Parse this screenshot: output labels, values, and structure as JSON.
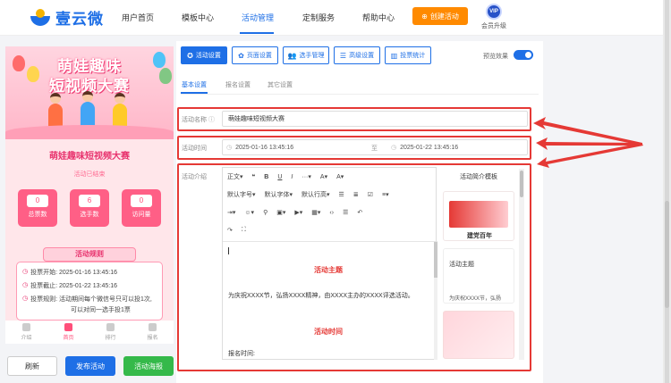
{
  "brand": {
    "name": "壹云微"
  },
  "nav": {
    "items": [
      "用户首页",
      "模板中心",
      "活动管理",
      "定制服务",
      "帮助中心"
    ],
    "active": "活动管理",
    "create_label": "创建活动",
    "vip_badge": "VIP",
    "vip_label": "会员升级"
  },
  "preview": {
    "banner_title_line1": "萌娃趣味",
    "banner_title_line2": "短视频大赛",
    "activity_name": "萌娃趣味短视频大赛",
    "status": "活动已结束",
    "stats": [
      {
        "value": "0",
        "label": "总票数"
      },
      {
        "value": "6",
        "label": "选手数"
      },
      {
        "value": "0",
        "label": "访问量"
      }
    ],
    "rules_title": "活动规则",
    "rules": [
      "投票开始: 2025-01-16 13:45:16",
      "投票截止: 2025-01-22 13:45:16",
      "投票规则: 活动期间每个微信号只可以投1次,",
      "可以对同一选手投1票"
    ],
    "tabs": [
      "介绍",
      "首页",
      "排行",
      "报名"
    ],
    "active_tab": "首页"
  },
  "bottom_buttons": {
    "refresh": "刷新",
    "publish": "发布活动",
    "poster": "活动海报"
  },
  "panel": {
    "toolbar": [
      "活动设置",
      "页面设置",
      "选手管理",
      "高级设置",
      "投票统计"
    ],
    "preview_effect_label": "预览效果",
    "subtabs": [
      "基本设置",
      "报名设置",
      "其它设置"
    ],
    "name_label": "活动名称",
    "name_value": "萌娃趣味短视频大赛",
    "time_label": "活动时间",
    "time_start": "2025-01-16 13:45:16",
    "time_sep": "至",
    "time_end": "2025-01-22 13:45:16",
    "intro_label": "活动介绍",
    "editor_toolbar": {
      "row1": [
        "正文",
        "❝",
        "B",
        "U",
        "I",
        "···",
        "A",
        "A"
      ],
      "row2": [
        "默认字号",
        "默认字体",
        "默认行高"
      ],
      "paragraph": "正文"
    },
    "editor_content": {
      "heading1": "活动主题",
      "para1": "为庆祝XXXX节，弘扬XXXX精神，由XXXX主办的XXXX评选活动。",
      "heading2": "活动时间",
      "para2": "报名时间:"
    },
    "templates": {
      "title": "活动简介模板",
      "card1_caption": "建党百年",
      "card2_title": "活动主题",
      "card2_text": "为庆祝XXXX节，弘扬"
    }
  },
  "colors": {
    "primary": "#1e6fe6",
    "accent": "#ff8a00",
    "highlight": "#e53935",
    "pink": "#ff4f7a"
  }
}
